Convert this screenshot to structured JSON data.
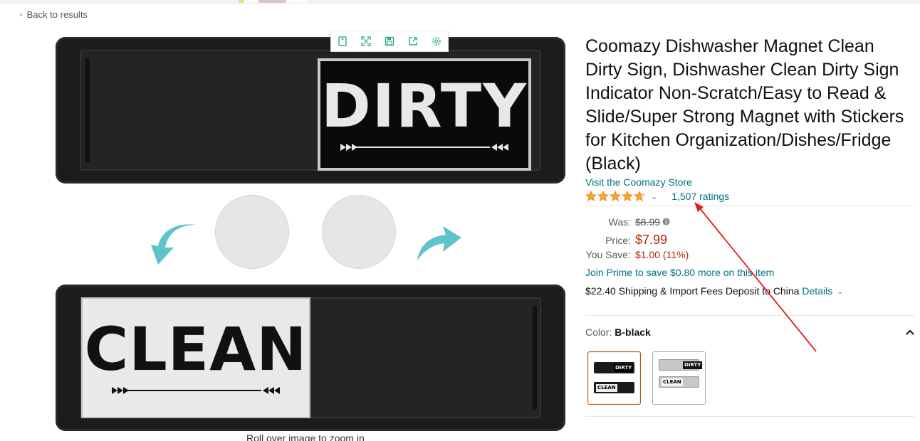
{
  "nav": {
    "back_label": "Back to results"
  },
  "image": {
    "dirty_text": "DIRTY",
    "clean_text": "CLEAN",
    "caption": "Roll over image to zoom in",
    "toolbar": [
      "bookmark-icon",
      "expand-icon",
      "save-icon",
      "share-icon",
      "settings-icon"
    ]
  },
  "product": {
    "title": "Coomazy Dishwasher Magnet Clean Dirty Sign, Dishwasher Clean Dirty Sign Indicator Non-Scratch/Easy to Read & Slide/Super Strong Magnet with Stickers for Kitchen Organization/Dishes/Fridge (Black)",
    "store_link": "Visit the Coomazy Store",
    "rating_stars": 4.5,
    "ratings_count": "1,507 ratings"
  },
  "pricing": {
    "was_label": "Was:",
    "was_value": "$8.99",
    "price_label": "Price:",
    "price_value": "$7.99",
    "save_label": "You Save:",
    "save_value": "$1.00 (11%)",
    "prime_text": "Join Prime to save $0.80 more on this item",
    "shipping_text": "$22.40 Shipping & Import Fees Deposit to China",
    "shipping_details": "Details"
  },
  "color": {
    "label": "Color:",
    "selected": "B-black",
    "swatches": [
      {
        "top": "DIRTY",
        "bottom": "CLEAN",
        "style": "black",
        "selected": true
      },
      {
        "top": "DIRTY",
        "bottom": "CLEAN",
        "style": "silver",
        "selected": false
      }
    ]
  },
  "colors": {
    "link": "#007185",
    "price": "#b12704",
    "star": "#ffa41c",
    "annotation_arrow": "#e41b1b",
    "teal_arrow": "#5ec3cb"
  }
}
